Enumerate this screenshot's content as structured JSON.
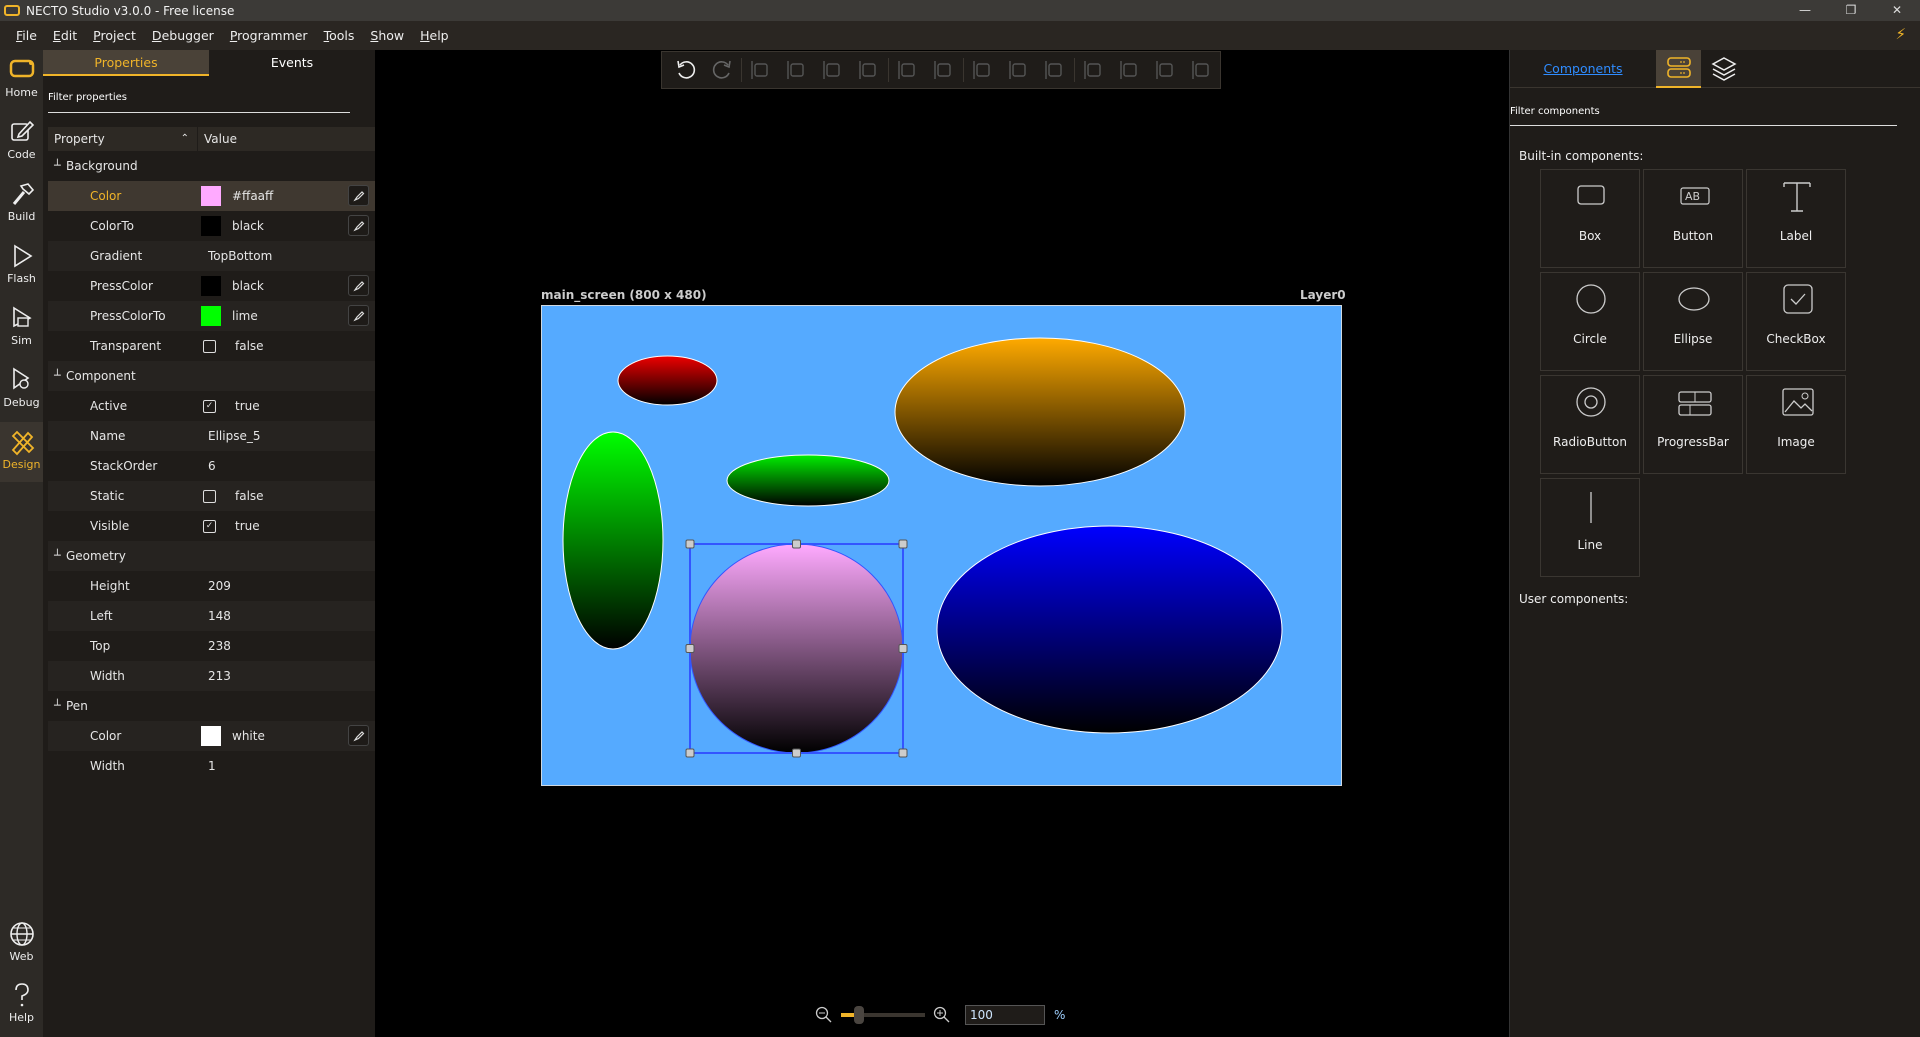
{
  "window": {
    "title": "NECTO Studio v3.0.0 - Free license",
    "controls": [
      "minimize-icon",
      "restore-icon",
      "close-icon"
    ]
  },
  "menu": [
    "File",
    "Edit",
    "Project",
    "Debugger",
    "Programmer",
    "Tools",
    "Show",
    "Help"
  ],
  "rail": {
    "top": [
      {
        "label": "Home",
        "icon": "home-icon"
      },
      {
        "label": "Code",
        "icon": "pencil-square-icon"
      },
      {
        "label": "Build",
        "icon": "hammer-icon"
      },
      {
        "label": "Flash",
        "icon": "play-icon"
      },
      {
        "label": "Sim",
        "icon": "simulator-icon"
      },
      {
        "label": "Debug",
        "icon": "bug-icon"
      },
      {
        "label": "Design",
        "icon": "design-tools-icon",
        "active": true
      }
    ],
    "bottom": [
      {
        "label": "Web",
        "icon": "globe-icon"
      },
      {
        "label": "Help",
        "icon": "question-icon"
      }
    ]
  },
  "left_panel": {
    "tabs": [
      {
        "label": "Properties",
        "active": true
      },
      {
        "label": "Events"
      }
    ],
    "filter_placeholder": "Filter properties",
    "columns": [
      "Property",
      "Value"
    ],
    "groups": [
      {
        "name": "Background",
        "rows": [
          {
            "name": "Color",
            "value": "#ffaaff",
            "swatch": "#ffaaff",
            "editable": true,
            "selected": true
          },
          {
            "name": "ColorTo",
            "value": "black",
            "swatch": "#000000",
            "editable": true
          },
          {
            "name": "Gradient",
            "value": "TopBottom"
          },
          {
            "name": "PressColor",
            "value": "black",
            "swatch": "#000000",
            "editable": true
          },
          {
            "name": "PressColorTo",
            "value": "lime",
            "swatch": "#00ff00",
            "editable": true
          },
          {
            "name": "Transparent",
            "value": "false",
            "checkbox": false
          }
        ]
      },
      {
        "name": "Component",
        "rows": [
          {
            "name": "Active",
            "value": "true",
            "checkbox": true
          },
          {
            "name": "Name",
            "value": "Ellipse_5"
          },
          {
            "name": "StackOrder",
            "value": "6"
          },
          {
            "name": "Static",
            "value": "false",
            "checkbox": false
          },
          {
            "name": "Visible",
            "value": "true",
            "checkbox": true
          }
        ]
      },
      {
        "name": "Geometry",
        "rows": [
          {
            "name": "Height",
            "value": "209"
          },
          {
            "name": "Left",
            "value": "148"
          },
          {
            "name": "Top",
            "value": "238"
          },
          {
            "name": "Width",
            "value": "213"
          }
        ]
      },
      {
        "name": "Pen",
        "rows": [
          {
            "name": "Color",
            "value": "white",
            "swatch": "#ffffff",
            "editable": true
          },
          {
            "name": "Width",
            "value": "1"
          }
        ]
      }
    ]
  },
  "toolbar": [
    "undo-icon",
    "redo-icon",
    "|",
    "align-left-icon",
    "align-top-icon",
    "align-bottom-icon",
    "align-right-icon",
    "|",
    "center-horizontal-icon",
    "center-vertical-icon",
    "|",
    "same-width-icon",
    "same-height-icon",
    "same-size-icon",
    "|",
    "distribute-horizontal-icon",
    "distribute-vertical-icon",
    "space-horizontal-icon",
    "space-vertical-icon"
  ],
  "canvas": {
    "screen_label": "main_screen (800 x 480)",
    "layer_label": "Layer0",
    "background": "#55aaff",
    "shapes": [
      {
        "name": "ellipse-red",
        "color": "#ee0000",
        "color_to": "#000000",
        "pen": "#ffffff"
      },
      {
        "name": "ellipse-orange",
        "color": "#ffaa00",
        "color_to": "#000000",
        "pen": "#ffffff"
      },
      {
        "name": "ellipse-green-tall",
        "color": "#00ff00",
        "color_to": "#000000",
        "pen": "#ffffff"
      },
      {
        "name": "ellipse-green-flat",
        "color": "#00ee00",
        "color_to": "#000000",
        "pen": "#ffffff"
      },
      {
        "name": "ellipse-blue",
        "color": "#0000ff",
        "color_to": "#000000",
        "pen": "#ffffff"
      },
      {
        "name": "Ellipse_5",
        "color": "#ffaaff",
        "color_to": "#000000",
        "pen": "#3355ff",
        "selected": true
      }
    ]
  },
  "zoom": {
    "value": "100",
    "unit": "%",
    "level_percent": 100
  },
  "right_panel": {
    "tab_label": "Components",
    "filter_placeholder": "Filter components",
    "builtin_label": "Built-in components:",
    "user_label": "User components:",
    "components": [
      {
        "label": "Box",
        "icon": "box-icon"
      },
      {
        "label": "Button",
        "icon": "button-icon",
        "icon_text": "AB"
      },
      {
        "label": "Label",
        "icon": "label-icon"
      },
      {
        "label": "Circle",
        "icon": "circle-icon"
      },
      {
        "label": "Ellipse",
        "icon": "ellipse-icon"
      },
      {
        "label": "CheckBox",
        "icon": "checkbox-icon"
      },
      {
        "label": "RadioButton",
        "icon": "radio-icon"
      },
      {
        "label": "ProgressBar",
        "icon": "progressbar-icon"
      },
      {
        "label": "Image",
        "icon": "image-icon"
      },
      {
        "label": "Line",
        "icon": "line-icon"
      }
    ]
  },
  "colors": {
    "accent": "#f0b429",
    "link": "#2f8cff",
    "panel": "#1f1c19"
  }
}
